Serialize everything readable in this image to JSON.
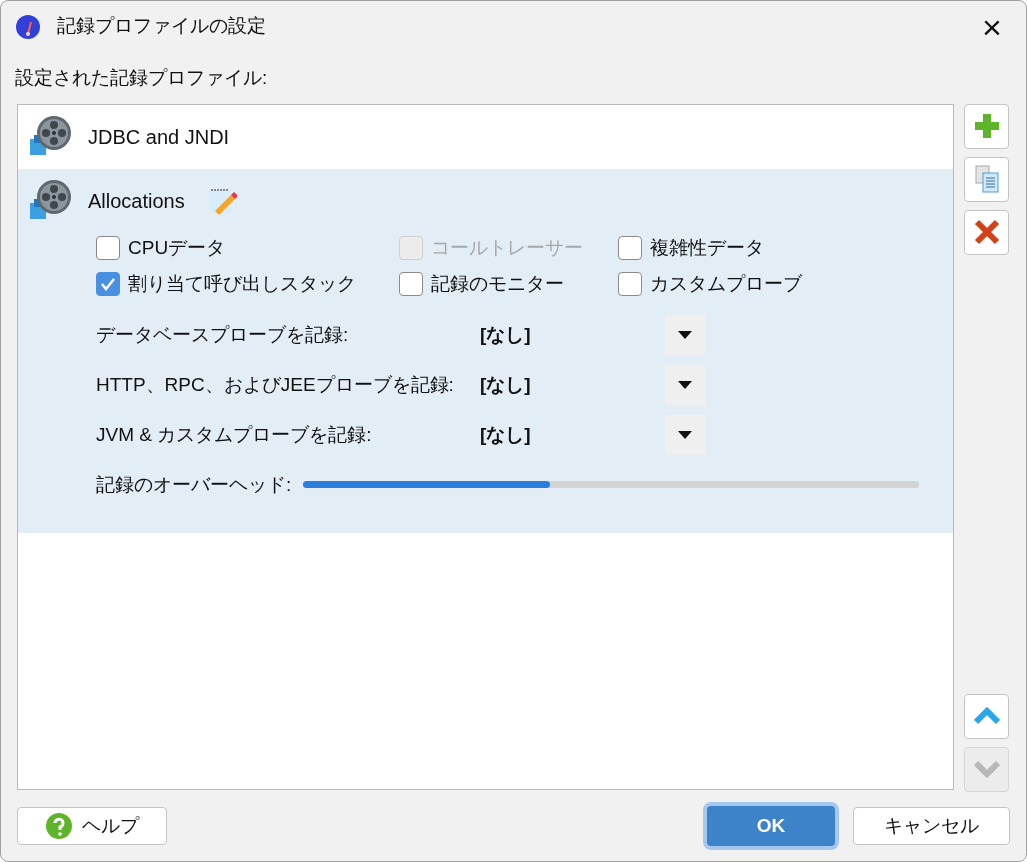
{
  "window": {
    "title": "記録プロファイルの設定",
    "close": "×"
  },
  "list_label": "設定された記録プロファイル:",
  "profiles": [
    {
      "name": "JDBC and JNDI",
      "selected": false,
      "expanded": false
    },
    {
      "name": "Allocations",
      "selected": true,
      "expanded": true
    }
  ],
  "options": {
    "checkboxes": [
      {
        "label": "CPUデータ",
        "checked": false,
        "disabled": false
      },
      {
        "label": "コールトレーサー",
        "checked": false,
        "disabled": true
      },
      {
        "label": "複雑性データ",
        "checked": false,
        "disabled": false
      },
      {
        "label": "割り当て呼び出しスタック",
        "checked": true,
        "disabled": false
      },
      {
        "label": "記録のモニター",
        "checked": false,
        "disabled": false
      },
      {
        "label": "カスタムプローブ",
        "checked": false,
        "disabled": false
      }
    ],
    "probes": [
      {
        "label": "データベースプローブを記録:",
        "value": "[なし]"
      },
      {
        "label": "HTTP、RPC、およびJEEプローブを記録:",
        "value": "[なし]"
      },
      {
        "label": "JVM & カスタムプローブを記録:",
        "value": "[なし]"
      }
    ],
    "overhead": {
      "label": "記録のオーバーヘッド:",
      "level": 0.4
    }
  },
  "side_buttons": [
    {
      "kind": "add",
      "disabled": false
    },
    {
      "kind": "copy",
      "disabled": false
    },
    {
      "kind": "delete",
      "disabled": false
    },
    {
      "kind": "up",
      "disabled": false
    },
    {
      "kind": "down",
      "disabled": true
    }
  ],
  "footer": {
    "help": "ヘルプ",
    "ok": "OK",
    "cancel": "キャンセル"
  }
}
